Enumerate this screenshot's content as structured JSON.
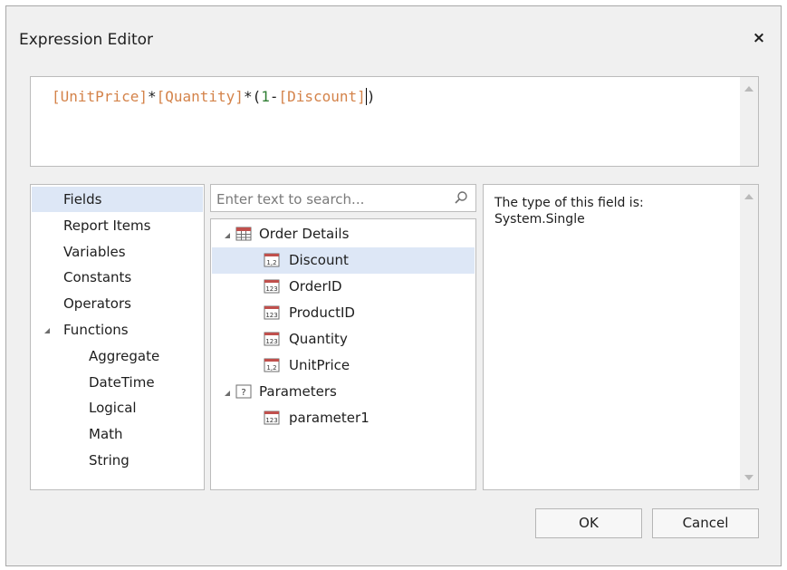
{
  "window": {
    "title": "Expression Editor",
    "close_glyph": "×"
  },
  "expression": {
    "tokens": [
      {
        "text": "[UnitPrice]",
        "kind": "field"
      },
      {
        "text": "*",
        "kind": "op"
      },
      {
        "text": "[Quantity]",
        "kind": "field"
      },
      {
        "text": "*(",
        "kind": "op"
      },
      {
        "text": "1",
        "kind": "num"
      },
      {
        "text": "-",
        "kind": "op"
      },
      {
        "text": "[Discount]",
        "kind": "field"
      },
      {
        "text": ")",
        "kind": "op"
      }
    ],
    "caret_after_token": 6
  },
  "categories": {
    "items": [
      {
        "label": "Fields",
        "selected": true
      },
      {
        "label": "Report Items"
      },
      {
        "label": "Variables"
      },
      {
        "label": "Constants"
      },
      {
        "label": "Operators"
      },
      {
        "label": "Functions",
        "expanded": true
      },
      {
        "label": "Aggregate",
        "child": true
      },
      {
        "label": "DateTime",
        "child": true
      },
      {
        "label": "Logical",
        "child": true
      },
      {
        "label": "Math",
        "child": true
      },
      {
        "label": "String",
        "child": true
      }
    ]
  },
  "search": {
    "placeholder": "Enter text to search...",
    "value": ""
  },
  "tree": {
    "rows": [
      {
        "label": "Order Details",
        "icon": "table-icon",
        "level": 0,
        "expanded": true
      },
      {
        "label": "Discount",
        "icon": "float-field-icon",
        "icon_text": "1,2",
        "level": 1,
        "selected": true
      },
      {
        "label": "OrderID",
        "icon": "int-field-icon",
        "icon_text": "123",
        "level": 1
      },
      {
        "label": "ProductID",
        "icon": "int-field-icon",
        "icon_text": "123",
        "level": 1
      },
      {
        "label": "Quantity",
        "icon": "int-field-icon",
        "icon_text": "123",
        "level": 1
      },
      {
        "label": "UnitPrice",
        "icon": "float-field-icon",
        "icon_text": "1,2",
        "level": 1
      },
      {
        "label": "Parameters",
        "icon": "parameters-icon",
        "icon_text": "?",
        "level": 0,
        "expanded": true
      },
      {
        "label": "parameter1",
        "icon": "int-field-icon",
        "icon_text": "123",
        "level": 1
      }
    ]
  },
  "description": {
    "text": "The type of this field is:\nSystem.Single"
  },
  "buttons": {
    "ok": "OK",
    "cancel": "Cancel"
  },
  "colors": {
    "field_token": "#d4834a",
    "number_token": "#2e7d32",
    "selection": "#dde7f6",
    "icon_accent": "#c0504d"
  }
}
